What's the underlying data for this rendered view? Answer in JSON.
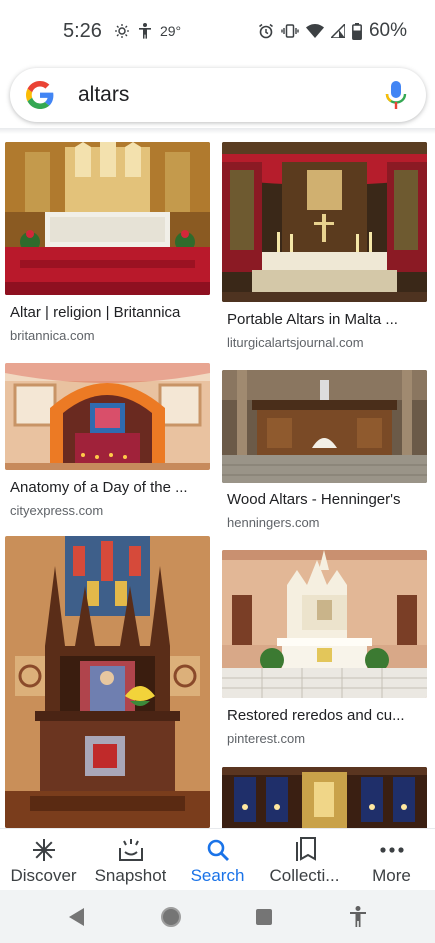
{
  "status_bar": {
    "time": "5:26",
    "temperature": "29°",
    "battery": "60%"
  },
  "search": {
    "query": "altars"
  },
  "results": [
    {
      "title": "Altar | religion | Britannica",
      "source": "britannica.com"
    },
    {
      "title": "Portable Altars in Malta ...",
      "source": "liturgicalartsjournal.com"
    },
    {
      "title": "Anatomy of a Day of the ...",
      "source": "cityexpress.com"
    },
    {
      "title": "Wood Altars - Henninger's",
      "source": "henningers.com"
    },
    {
      "title": "",
      "source": ""
    },
    {
      "title": "Restored reredos and cu...",
      "source": "pinterest.com"
    },
    {
      "title": "",
      "source": ""
    }
  ],
  "bottom_nav": {
    "items": [
      {
        "label": "Discover",
        "icon": "asterisk-icon",
        "active": false
      },
      {
        "label": "Snapshot",
        "icon": "snapshot-icon",
        "active": false
      },
      {
        "label": "Search",
        "icon": "search-icon",
        "active": true
      },
      {
        "label": "Collecti...",
        "icon": "collections-icon",
        "active": false
      },
      {
        "label": "More",
        "icon": "more-dots-icon",
        "active": false
      }
    ]
  },
  "colors": {
    "accent": "#1a73e8",
    "text": "#202124",
    "secondary_text": "#5f6368"
  }
}
